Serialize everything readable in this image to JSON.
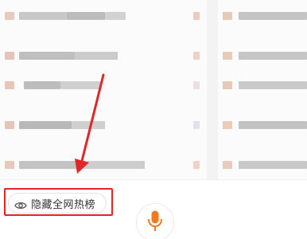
{
  "hot_list": {
    "hide_toggle_label": "隐藏全网热榜",
    "hide_toggle_icon": "eye-icon"
  },
  "voice_search": {
    "icon": "microphone-icon",
    "accent_color": "#f07a1f"
  },
  "annotation": {
    "frame_color": "#e02727",
    "arrow_color": "#e02727"
  }
}
